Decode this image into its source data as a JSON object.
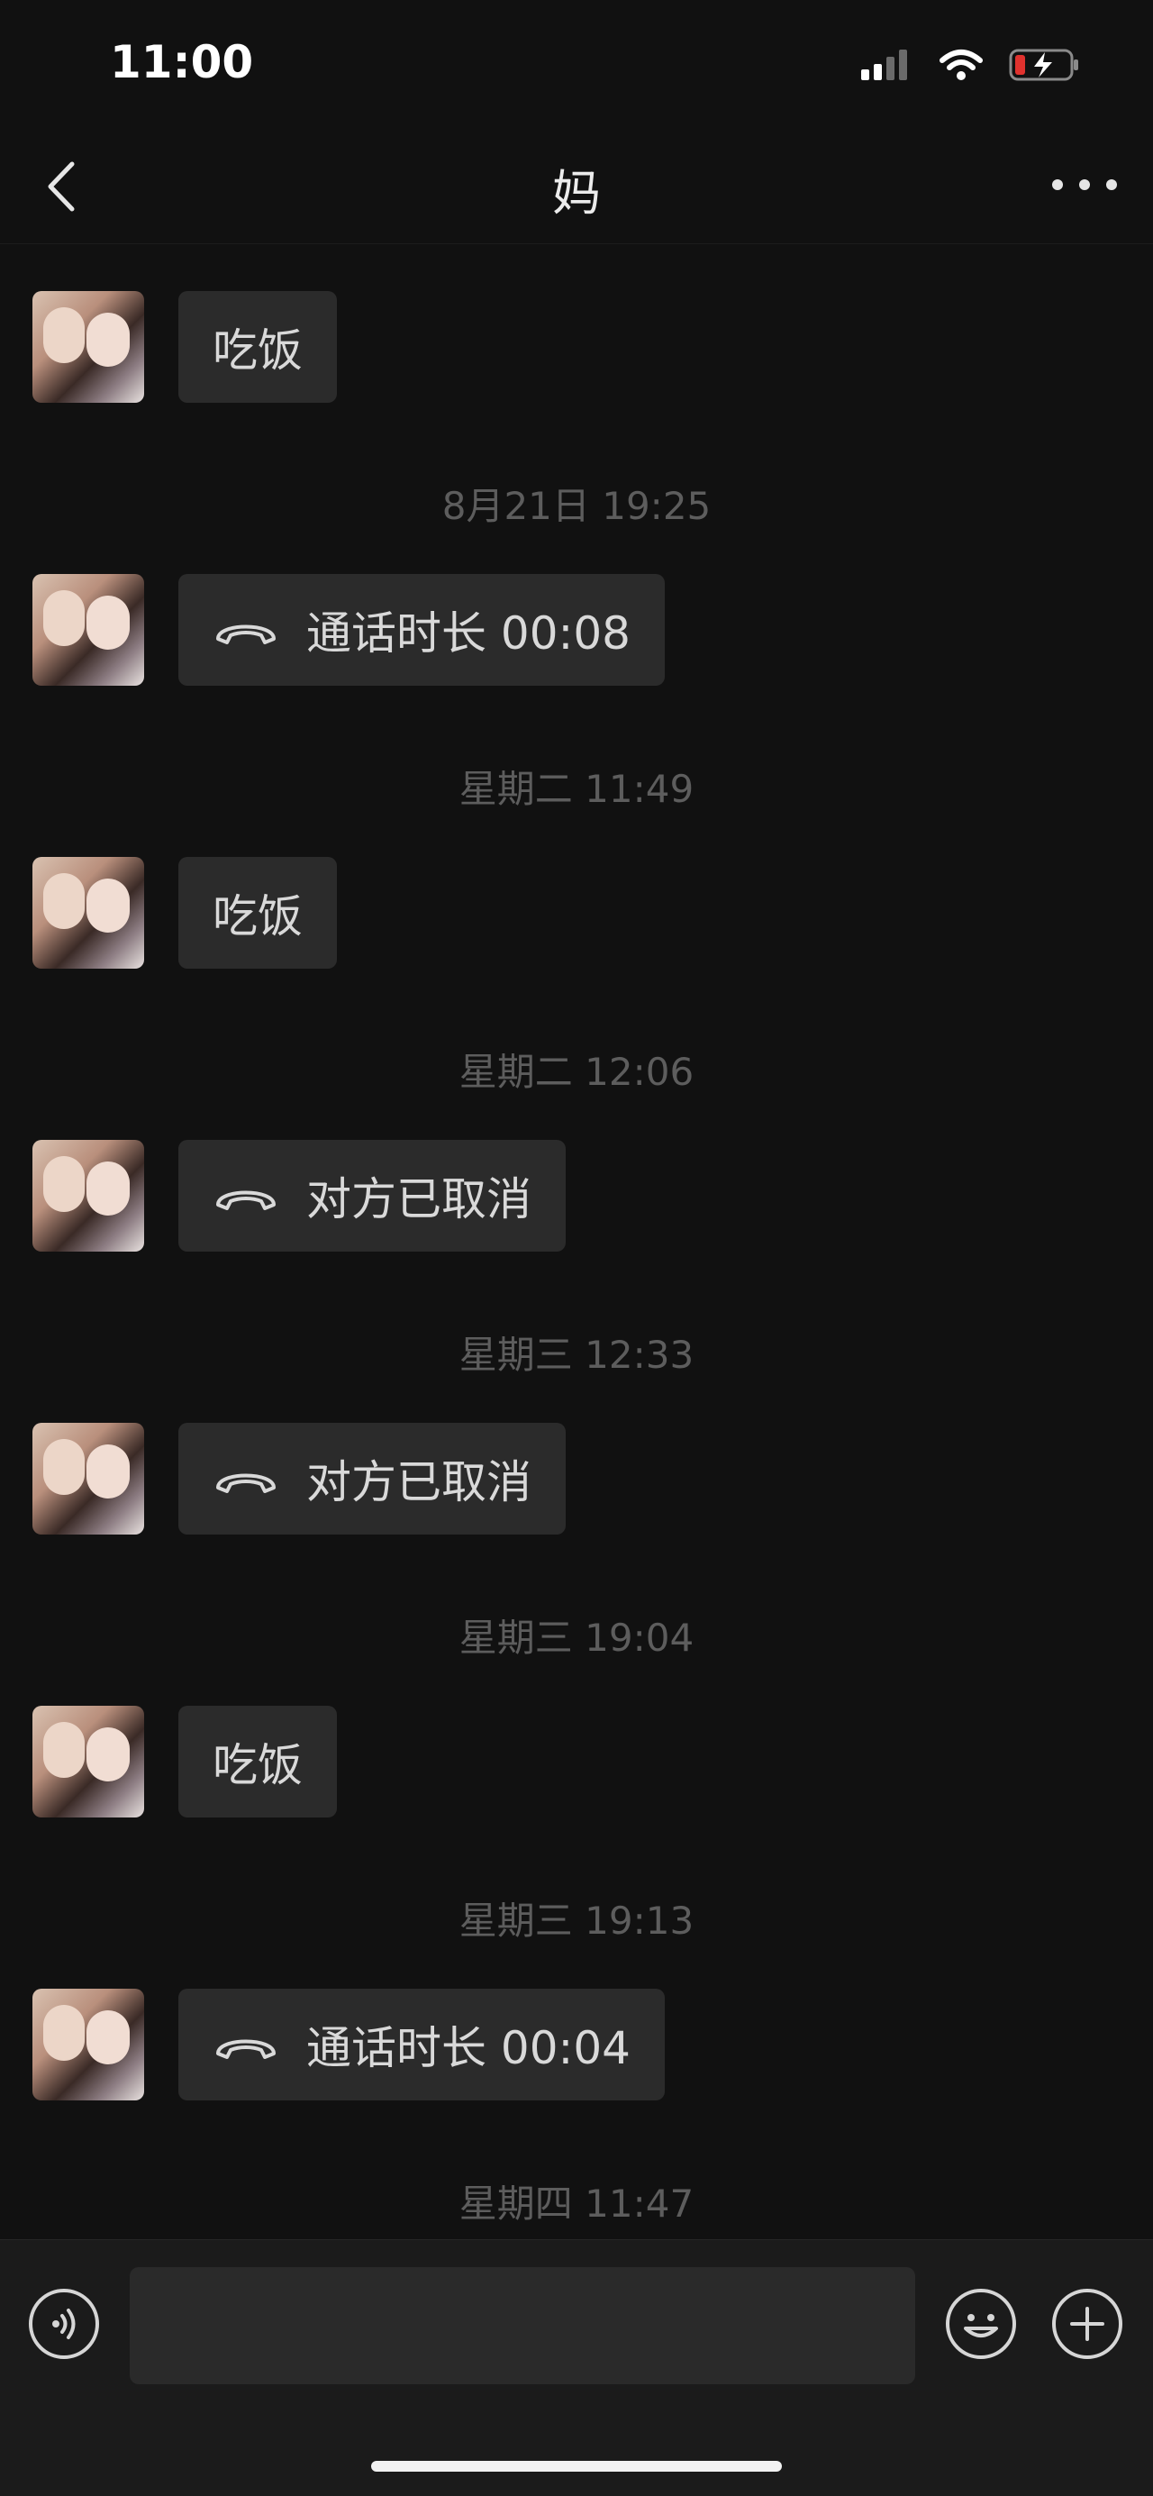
{
  "status": {
    "time": "11:00"
  },
  "header": {
    "title": "妈"
  },
  "messages": [
    {
      "kind": "text",
      "text": "吃饭"
    },
    {
      "kind": "call",
      "text": "通话时长 00:08"
    },
    {
      "kind": "text",
      "text": "吃饭"
    },
    {
      "kind": "call",
      "text": "对方已取消"
    },
    {
      "kind": "call",
      "text": "对方已取消"
    },
    {
      "kind": "text",
      "text": "吃饭"
    },
    {
      "kind": "call",
      "text": "通话时长 00:04"
    }
  ],
  "timestamps": [
    "8月21日 19:25",
    "星期二 11:49",
    "星期二 12:06",
    "星期三 12:33",
    "星期三 19:04",
    "星期三 19:13",
    "星期四 11:47"
  ],
  "colors": {
    "background": "#111111",
    "bubble": "#2b2b2b",
    "timestamp": "#5d5d5d",
    "input_bar": "#1b1b1b",
    "battery_low": "#e0322e"
  },
  "icons": {
    "back": "chevron-left-icon",
    "more": "more-dots-icon",
    "call": "phone-hangup-icon",
    "voice": "voice-icon",
    "emoji": "emoji-icon",
    "plus": "plus-icon"
  },
  "input": {
    "placeholder": "",
    "value": ""
  }
}
